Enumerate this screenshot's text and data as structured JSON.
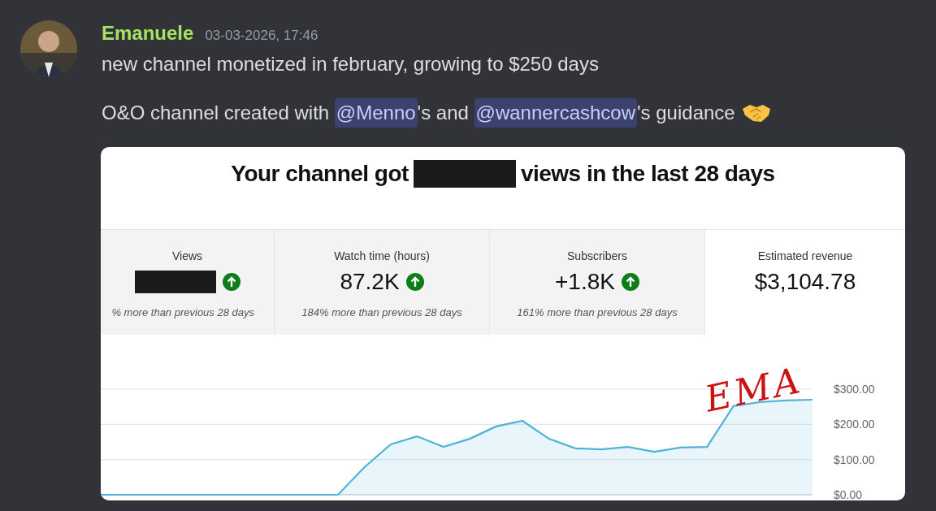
{
  "message": {
    "author": "Emanuele",
    "timestamp": "03-03-2026, 17:46",
    "paragraphs": [
      [
        {
          "kind": "text",
          "text": "new channel monetized in february, growing to $250 days"
        }
      ],
      [
        {
          "kind": "text",
          "text": "O&O channel created with "
        },
        {
          "kind": "mention",
          "text": "@Menno"
        },
        {
          "kind": "text",
          "text": "'s and "
        },
        {
          "kind": "mention",
          "text": "@wannercashcow"
        },
        {
          "kind": "text",
          "text": "'s guidance"
        },
        {
          "kind": "emoji"
        }
      ]
    ]
  },
  "attachment": {
    "headline": [
      {
        "kind": "text",
        "text": "Your channel got"
      },
      {
        "kind": "redacted"
      },
      {
        "kind": "text",
        "text": "views in the last 28 days"
      }
    ],
    "metrics": [
      {
        "label": "Views",
        "redacted": true,
        "trend_up": true,
        "change": "% more than previous 28 days",
        "selected": false
      },
      {
        "label": "Watch time (hours)",
        "value": "87.2K",
        "redacted": false,
        "trend_up": true,
        "change": "184% more than previous 28 days",
        "selected": false
      },
      {
        "label": "Subscribers",
        "value": "+1.8K",
        "redacted": false,
        "trend_up": true,
        "change": "161% more than previous 28 days",
        "selected": false
      },
      {
        "label": "Estimated revenue",
        "value": "$3,104.78",
        "redacted": false,
        "trend_up": false,
        "selected": true
      }
    ],
    "chart_data": {
      "type": "area",
      "series": [
        {
          "color": "#4fb3d9",
          "values": [
            0,
            0,
            0,
            0,
            0,
            0,
            0,
            0,
            0,
            0,
            78,
            143,
            166,
            136,
            159,
            194,
            210,
            159,
            132,
            129,
            136,
            122,
            134,
            136,
            252,
            263,
            268,
            270
          ]
        }
      ],
      "ylim": [
        0,
        300
      ],
      "yticks": [
        {
          "value": 0,
          "label": "$0.00"
        },
        {
          "value": 100,
          "label": "$100.00"
        },
        {
          "value": 200,
          "label": "$200.00"
        },
        {
          "value": 300,
          "label": "$300.00"
        }
      ],
      "annotations": [
        {
          "text": "EMA"
        }
      ]
    }
  }
}
